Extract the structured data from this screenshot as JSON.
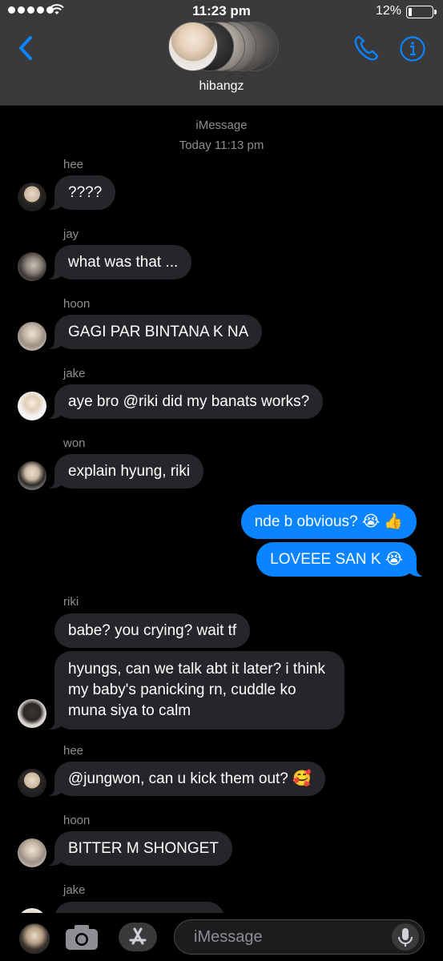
{
  "status_bar": {
    "time": "11:23 pm",
    "battery": "12%"
  },
  "header": {
    "group_name": "hibangz"
  },
  "conversation": {
    "service": "iMessage",
    "timestamp": "Today 11:13 pm",
    "messages": [
      {
        "sender": "hee",
        "text": "????"
      },
      {
        "sender": "jay",
        "text": "what was that ..."
      },
      {
        "sender": "hoon",
        "text": "GAGI PAR BINTANA K NA"
      },
      {
        "sender": "jake",
        "text": "aye bro @riki did my banats works?"
      },
      {
        "sender": "won",
        "text": "explain hyung, riki"
      },
      {
        "sender": "me",
        "text": "nde b obvious? 😭 👍"
      },
      {
        "sender": "me",
        "text": "LOVEEE SAN K 😭"
      },
      {
        "sender": "riki",
        "text": "babe? you crying? wait tf"
      },
      {
        "sender": "riki",
        "text": "hyungs, can we talk abt it later? i think my baby's panicking rn, cuddle ko muna siya to calm"
      },
      {
        "sender": "hee",
        "text": "@jungwon, can u kick them out? 🥰"
      },
      {
        "sender": "hoon",
        "text": "BITTER M SHONGET"
      },
      {
        "sender": "jake",
        "text": ""
      }
    ]
  },
  "input": {
    "placeholder": "iMessage"
  },
  "colors": {
    "header_bg": "#3a3a3c",
    "incoming_bubble": "#26252a",
    "outgoing_bubble": "#0a84ff",
    "accent": "#0a84ff"
  }
}
